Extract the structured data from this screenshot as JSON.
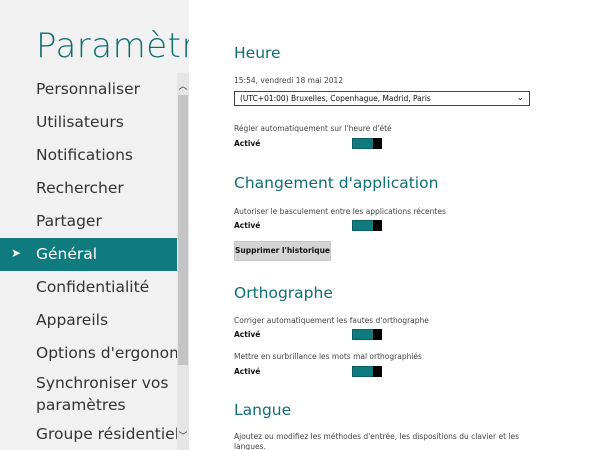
{
  "sidebar": {
    "title": "Paramètr...",
    "items": [
      {
        "label": "Personnaliser"
      },
      {
        "label": "Utilisateurs"
      },
      {
        "label": "Notifications"
      },
      {
        "label": "Rechercher"
      },
      {
        "label": "Partager"
      },
      {
        "label": "Général",
        "selected": true
      },
      {
        "label": "Confidentialité"
      },
      {
        "label": "Appareils"
      },
      {
        "label": "Options d'ergonomie"
      },
      {
        "label": "Synchroniser vos paramètres"
      },
      {
        "label": "Groupe résidentiel"
      }
    ],
    "scroll_up_icon": "chevron-up-icon",
    "scroll_down_icon": "chevron-down-icon"
  },
  "main": {
    "time": {
      "title": "Heure",
      "datetime": "15:54, vendredi 18 mai 2012",
      "timezone_value": "(UTC+01:00) Bruxelles, Copenhague, Madrid, Paris",
      "dst_label": "Régler automatiquement sur l'heure d'été",
      "dst_status": "Activé",
      "dst_on": true
    },
    "app_switching": {
      "title": "Changement d'application",
      "switch_label": "Autoriser le basculement entre les applications récentes",
      "switch_status": "Activé",
      "switch_on": true,
      "clear_history_label": "Supprimer l'historique"
    },
    "spelling": {
      "title": "Orthographe",
      "autocorrect_label": "Corriger automatiquement les fautes d'orthographe",
      "autocorrect_status": "Activé",
      "autocorrect_on": true,
      "highlight_label": "Mettre en surbrillance les mots mal orthographiés",
      "highlight_status": "Activé",
      "highlight_on": true
    },
    "language": {
      "title": "Langue",
      "description": "Ajoutez ou modifiez les méthodes d'entrée, les dispositions du clavier et les langues."
    }
  },
  "colors": {
    "accent": "#0f7b7f",
    "title": "#0f6e72",
    "sidebar_bg": "#f1f1f1"
  }
}
